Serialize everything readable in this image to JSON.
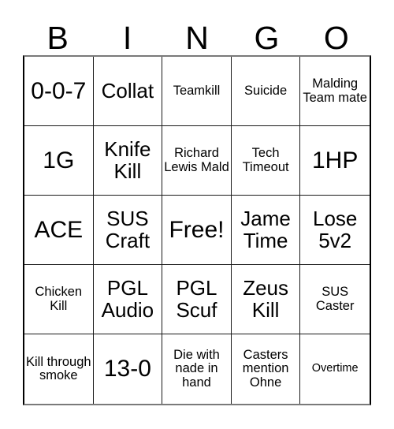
{
  "card": {
    "title": "BINGO",
    "headers": [
      "B",
      "I",
      "N",
      "G",
      "O"
    ],
    "rows": [
      [
        {
          "text": "0-0-7",
          "size": "fs-xl"
        },
        {
          "text": "Collat",
          "size": "fs-lg"
        },
        {
          "text": "Teamkill",
          "size": "fs-sm"
        },
        {
          "text": "Suicide",
          "size": "fs-sm"
        },
        {
          "text": "Malding Team mate",
          "size": "fs-sm"
        }
      ],
      [
        {
          "text": "1G",
          "size": "fs-xl"
        },
        {
          "text": "Knife Kill",
          "size": "fs-lg"
        },
        {
          "text": "Richard Lewis Mald",
          "size": "fs-sm"
        },
        {
          "text": "Tech Timeout",
          "size": "fs-sm"
        },
        {
          "text": "1HP",
          "size": "fs-xl"
        }
      ],
      [
        {
          "text": "ACE",
          "size": "fs-xl"
        },
        {
          "text": "SUS Craft",
          "size": "fs-lg"
        },
        {
          "text": "Free!",
          "size": "fs-xl"
        },
        {
          "text": "Jame Time",
          "size": "fs-lg"
        },
        {
          "text": "Lose 5v2",
          "size": "fs-lg"
        }
      ],
      [
        {
          "text": "Chicken Kill",
          "size": "fs-sm"
        },
        {
          "text": "PGL Audio",
          "size": "fs-lg"
        },
        {
          "text": "PGL Scuf",
          "size": "fs-lg"
        },
        {
          "text": "Zeus Kill",
          "size": "fs-lg"
        },
        {
          "text": "SUS Caster",
          "size": "fs-sm"
        }
      ],
      [
        {
          "text": "Kill through smoke",
          "size": "fs-sm"
        },
        {
          "text": "13-0",
          "size": "fs-xl"
        },
        {
          "text": "Die with nade in hand",
          "size": "fs-sm"
        },
        {
          "text": "Casters mention Ohne",
          "size": "fs-sm"
        },
        {
          "text": "Overtime",
          "size": "fs-xs"
        }
      ]
    ],
    "free_space": {
      "row": 3,
      "column": 3,
      "label": "Free!"
    },
    "colors": {
      "background": "#ffffff",
      "text": "#000000",
      "cell_border": "#1a1a1a",
      "outer_border": "#7a7a7a"
    }
  }
}
